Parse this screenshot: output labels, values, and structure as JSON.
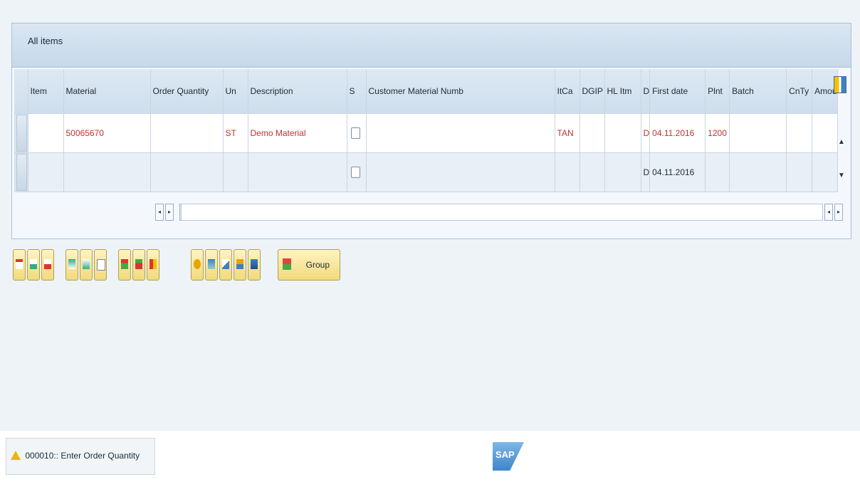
{
  "panel": {
    "title": "All items"
  },
  "table": {
    "columns": [
      "",
      "Item",
      "Material",
      "Order Quantity",
      "Un",
      "Description",
      "S",
      "Customer Material Numb",
      "ItCa",
      "DGIP",
      "HL Itm",
      "D",
      "First date",
      "Plnt",
      "Batch",
      "CnTy",
      "Amou"
    ],
    "rows": [
      {
        "item": "",
        "material": "50065670",
        "order_quantity": "",
        "un": "ST",
        "description": "Demo Material",
        "customer_material": "",
        "itca": "TAN",
        "dgip": "",
        "hl_itm": "",
        "d": "D",
        "first_date": "04.11.2016",
        "plnt": "1200",
        "batch": "",
        "cnty": "",
        "amou": ""
      },
      {
        "item": "",
        "material": "",
        "order_quantity": "",
        "un": "",
        "description": "",
        "customer_material": "",
        "itca": "",
        "dgip": "",
        "hl_itm": "",
        "d": "D",
        "first_date": "04.11.2016",
        "plnt": "",
        "batch": "",
        "cnty": "",
        "amou": ""
      }
    ]
  },
  "scroll": {
    "up": "▲",
    "down": "▼",
    "left": "◂",
    "right": "▸"
  },
  "toolbar": {
    "group_label": "Group"
  },
  "status": {
    "message": "000010:: Enter Order Quantity",
    "icon": "warning-icon"
  },
  "brand": {
    "logo_text": "SAP"
  },
  "colors": {
    "accent": "#f1d97c",
    "header": "#cfdeec",
    "error_text": "#c0322c"
  }
}
